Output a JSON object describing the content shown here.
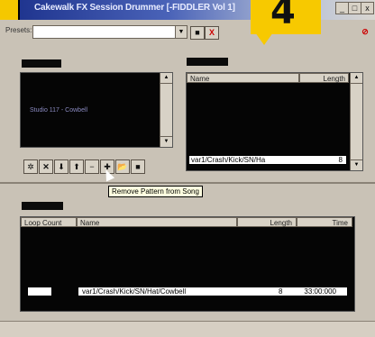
{
  "window": {
    "title": "Cakewalk FX Session Drummer [-FIDDLER Vol 1]",
    "minimize": "_",
    "maximize": "□",
    "close": "x"
  },
  "callout": {
    "number": "4"
  },
  "preset": {
    "label": "Presets:",
    "value": ""
  },
  "toolbar": {
    "save_label": "■",
    "delete_label": "X"
  },
  "style_list": {
    "items": [
      "Studio 117 - Cowbell"
    ]
  },
  "pattern_list": {
    "columns": [
      "Name",
      "Length"
    ],
    "selected": {
      "name": "var1/Crash/Kick/SN/Ha",
      "length": "8"
    }
  },
  "pattern_buttons": [
    "✲",
    "✕",
    "⬇",
    "⬆",
    "−",
    "✚",
    "📂",
    "■"
  ],
  "tooltip": "Remove Pattern from Song",
  "song": {
    "columns": [
      "Loop Count",
      "Name",
      "Length",
      "Time"
    ],
    "selected": {
      "loop": "",
      "name": "var1/Crash/Kick/SN/Hat/Cowbell",
      "length": "8",
      "time": "33:00:000"
    }
  },
  "accent_color": "#f7c900"
}
